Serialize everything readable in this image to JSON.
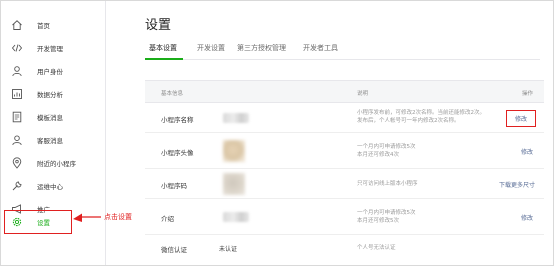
{
  "sidebar": {
    "items": [
      {
        "label": "首页",
        "icon": "home-icon"
      },
      {
        "label": "开发管理",
        "icon": "code-icon"
      },
      {
        "label": "用户身份",
        "icon": "user-icon"
      },
      {
        "label": "数据分析",
        "icon": "chart-icon"
      },
      {
        "label": "模板消息",
        "icon": "document-icon"
      },
      {
        "label": "客服消息",
        "icon": "support-icon"
      },
      {
        "label": "附近的小程序",
        "icon": "location-icon"
      },
      {
        "label": "运维中心",
        "icon": "wrench-icon"
      },
      {
        "label": "推广",
        "icon": "megaphone-icon"
      },
      {
        "label": "设置",
        "icon": "gear-icon"
      }
    ]
  },
  "annotation": {
    "text": "点击设置",
    "color": "#e02020"
  },
  "page": {
    "title": "设置",
    "tabs": [
      {
        "label": "基本设置"
      },
      {
        "label": "开发设置"
      },
      {
        "label": "第三方授权管理"
      },
      {
        "label": "开发者工具"
      }
    ]
  },
  "panel": {
    "header": {
      "col1": "基本信息",
      "col2": "说明",
      "col3": "操作"
    },
    "rows": [
      {
        "label": "小程序名称",
        "desc": [
          "小程序发布前，可修改2次名称。当前还能修改2次。",
          "发布后，个人帐号可一年内修改2次名称。"
        ],
        "action": "修改"
      },
      {
        "label": "小程序头像",
        "desc": [
          "一个月内可申请修改5次",
          "本月还可修改4次"
        ],
        "action": "修改"
      },
      {
        "label": "小程序码",
        "desc": [
          "只可访问线上版本小程序"
        ],
        "action": "下载更多尺寸"
      },
      {
        "label": "介绍",
        "desc": [
          "一个月内可申请修改5次",
          "本月还可修改5次"
        ],
        "action": "修改"
      },
      {
        "label": "微信认证",
        "value": "未认证",
        "desc": [
          "个人号无法认证"
        ],
        "action": ""
      }
    ]
  },
  "colors": {
    "accent": "#1aad19",
    "link": "#576b95",
    "highlight": "#e02020"
  }
}
